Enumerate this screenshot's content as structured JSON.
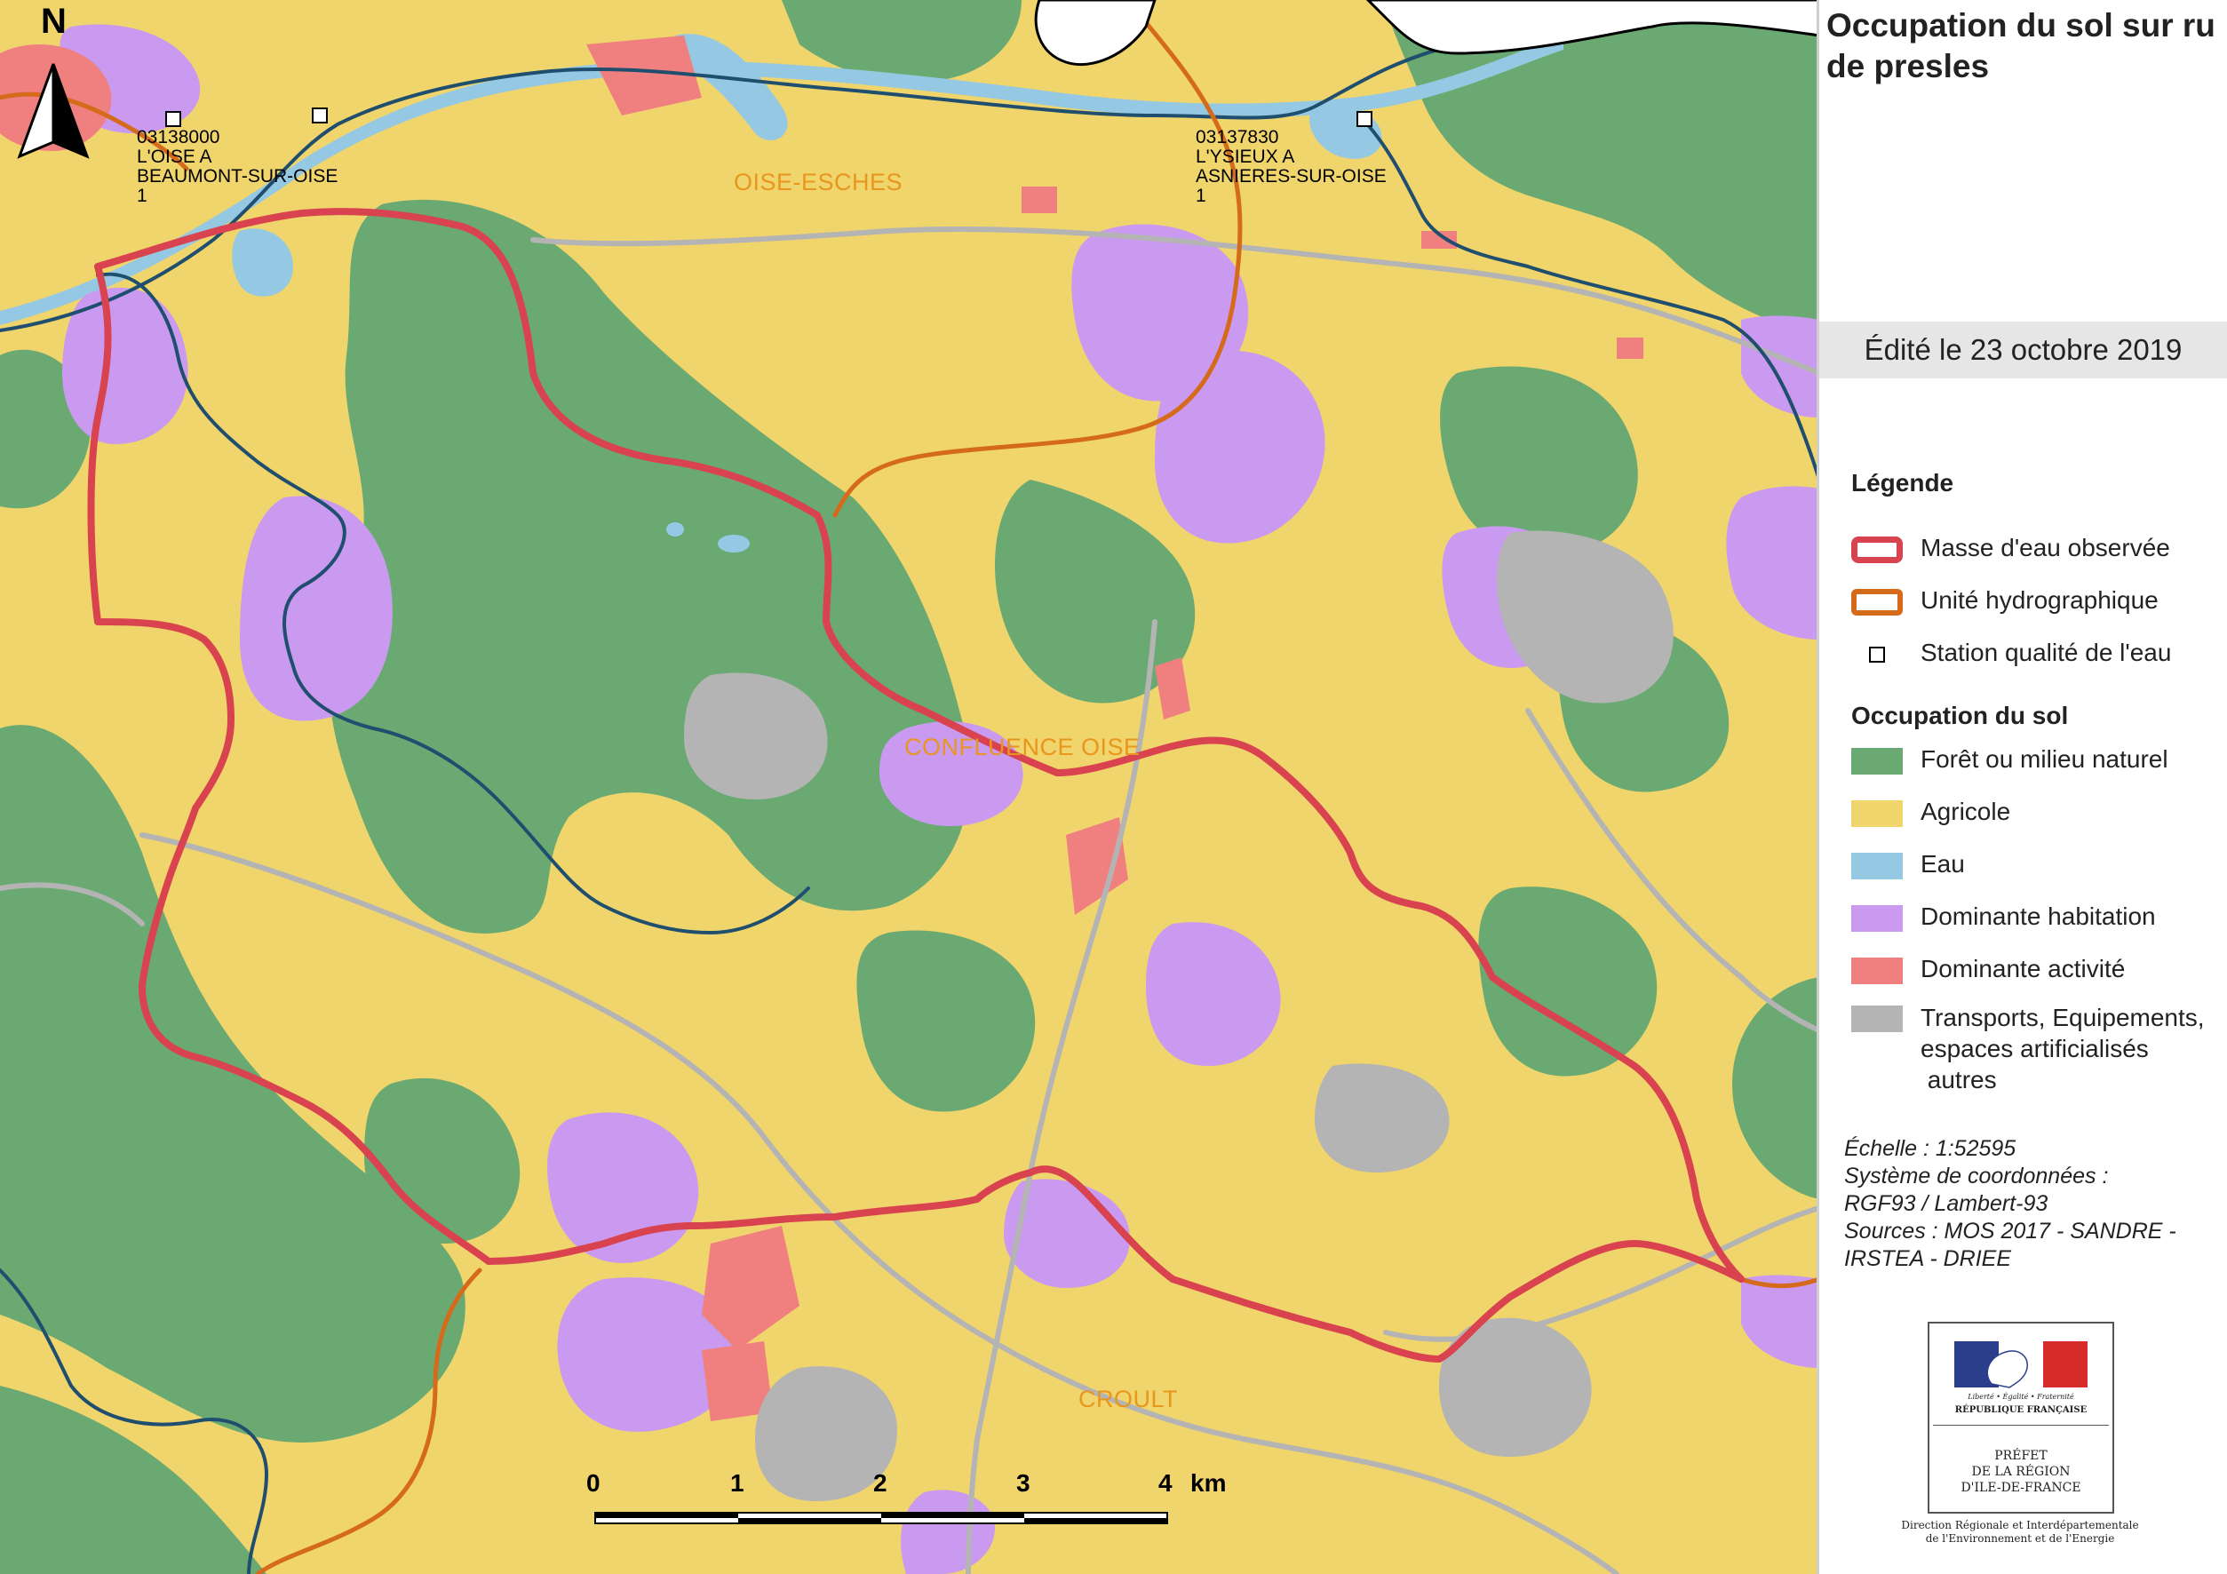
{
  "map": {
    "north_label": "N",
    "basin_labels": [
      "OISE-ESCHES",
      "CONFLUENCE OISE",
      "CROULT"
    ],
    "stations": [
      {
        "label": "03138000\nL'OISE A\nBEAUMONT-SUR-OISE\n1"
      },
      {
        "label": "03137830\nL'YSIEUX A\nASNIERES-SUR-OISE\n1"
      }
    ],
    "scale_bar": {
      "labels": [
        "0",
        "1",
        "2",
        "3",
        "4"
      ],
      "unit": "km"
    },
    "colors": {
      "forest": "#6aaa72",
      "agriculture": "#f0d46c",
      "water": "#95c9e3",
      "housing": "#c99af0",
      "activity": "#f08080",
      "transport": "#b4b4b4",
      "observed_water_body": "#d8434f",
      "hydro_unit": "#d46a1a",
      "river_line": "#1f4e6e"
    }
  },
  "panel": {
    "title": "Occupation du sol sur ru de presles",
    "edited": "Édité le 23 octobre 2019",
    "legend_title": "Légende",
    "legend_lines": [
      {
        "label": "Masse d'eau observée",
        "kind": "outline",
        "color": "#d8434f"
      },
      {
        "label": "Unité hydrographique",
        "kind": "outline",
        "color": "#d46a1a"
      },
      {
        "label": "Station qualité de l'eau",
        "kind": "station"
      }
    ],
    "landuse_title": "Occupation du sol",
    "landuse": [
      {
        "label": "Forêt ou milieu naturel",
        "color": "#6aaa72"
      },
      {
        "label": "Agricole",
        "color": "#f0d46c"
      },
      {
        "label": "Eau",
        "color": "#95c9e3"
      },
      {
        "label": "Dominante habitation",
        "color": "#c99af0"
      },
      {
        "label": "Dominante activité",
        "color": "#f08080"
      },
      {
        "label": "Transports, Equipements,\nespaces artificialisés\n autres",
        "color": "#b4b4b4"
      }
    ],
    "meta": {
      "scale": "Échelle :  1:52595",
      "crs_label": "Système de coordonnées :",
      "crs_value": "RGF93 / Lambert-93",
      "sources": "Sources : MOS 2017 - SANDRE -\nIRSTEA - DRIEE"
    },
    "logo": {
      "motto": "Liberté • Égalité • Fraternité",
      "republic": "RÉPUBLIQUE FRANÇAISE",
      "prefet": "PRÉFET\nDE LA RÉGION\nD'ILE-DE-FRANCE",
      "footer": "Direction Régionale et Interdépartementale\nde l'Environnement et de l'Energie"
    }
  }
}
